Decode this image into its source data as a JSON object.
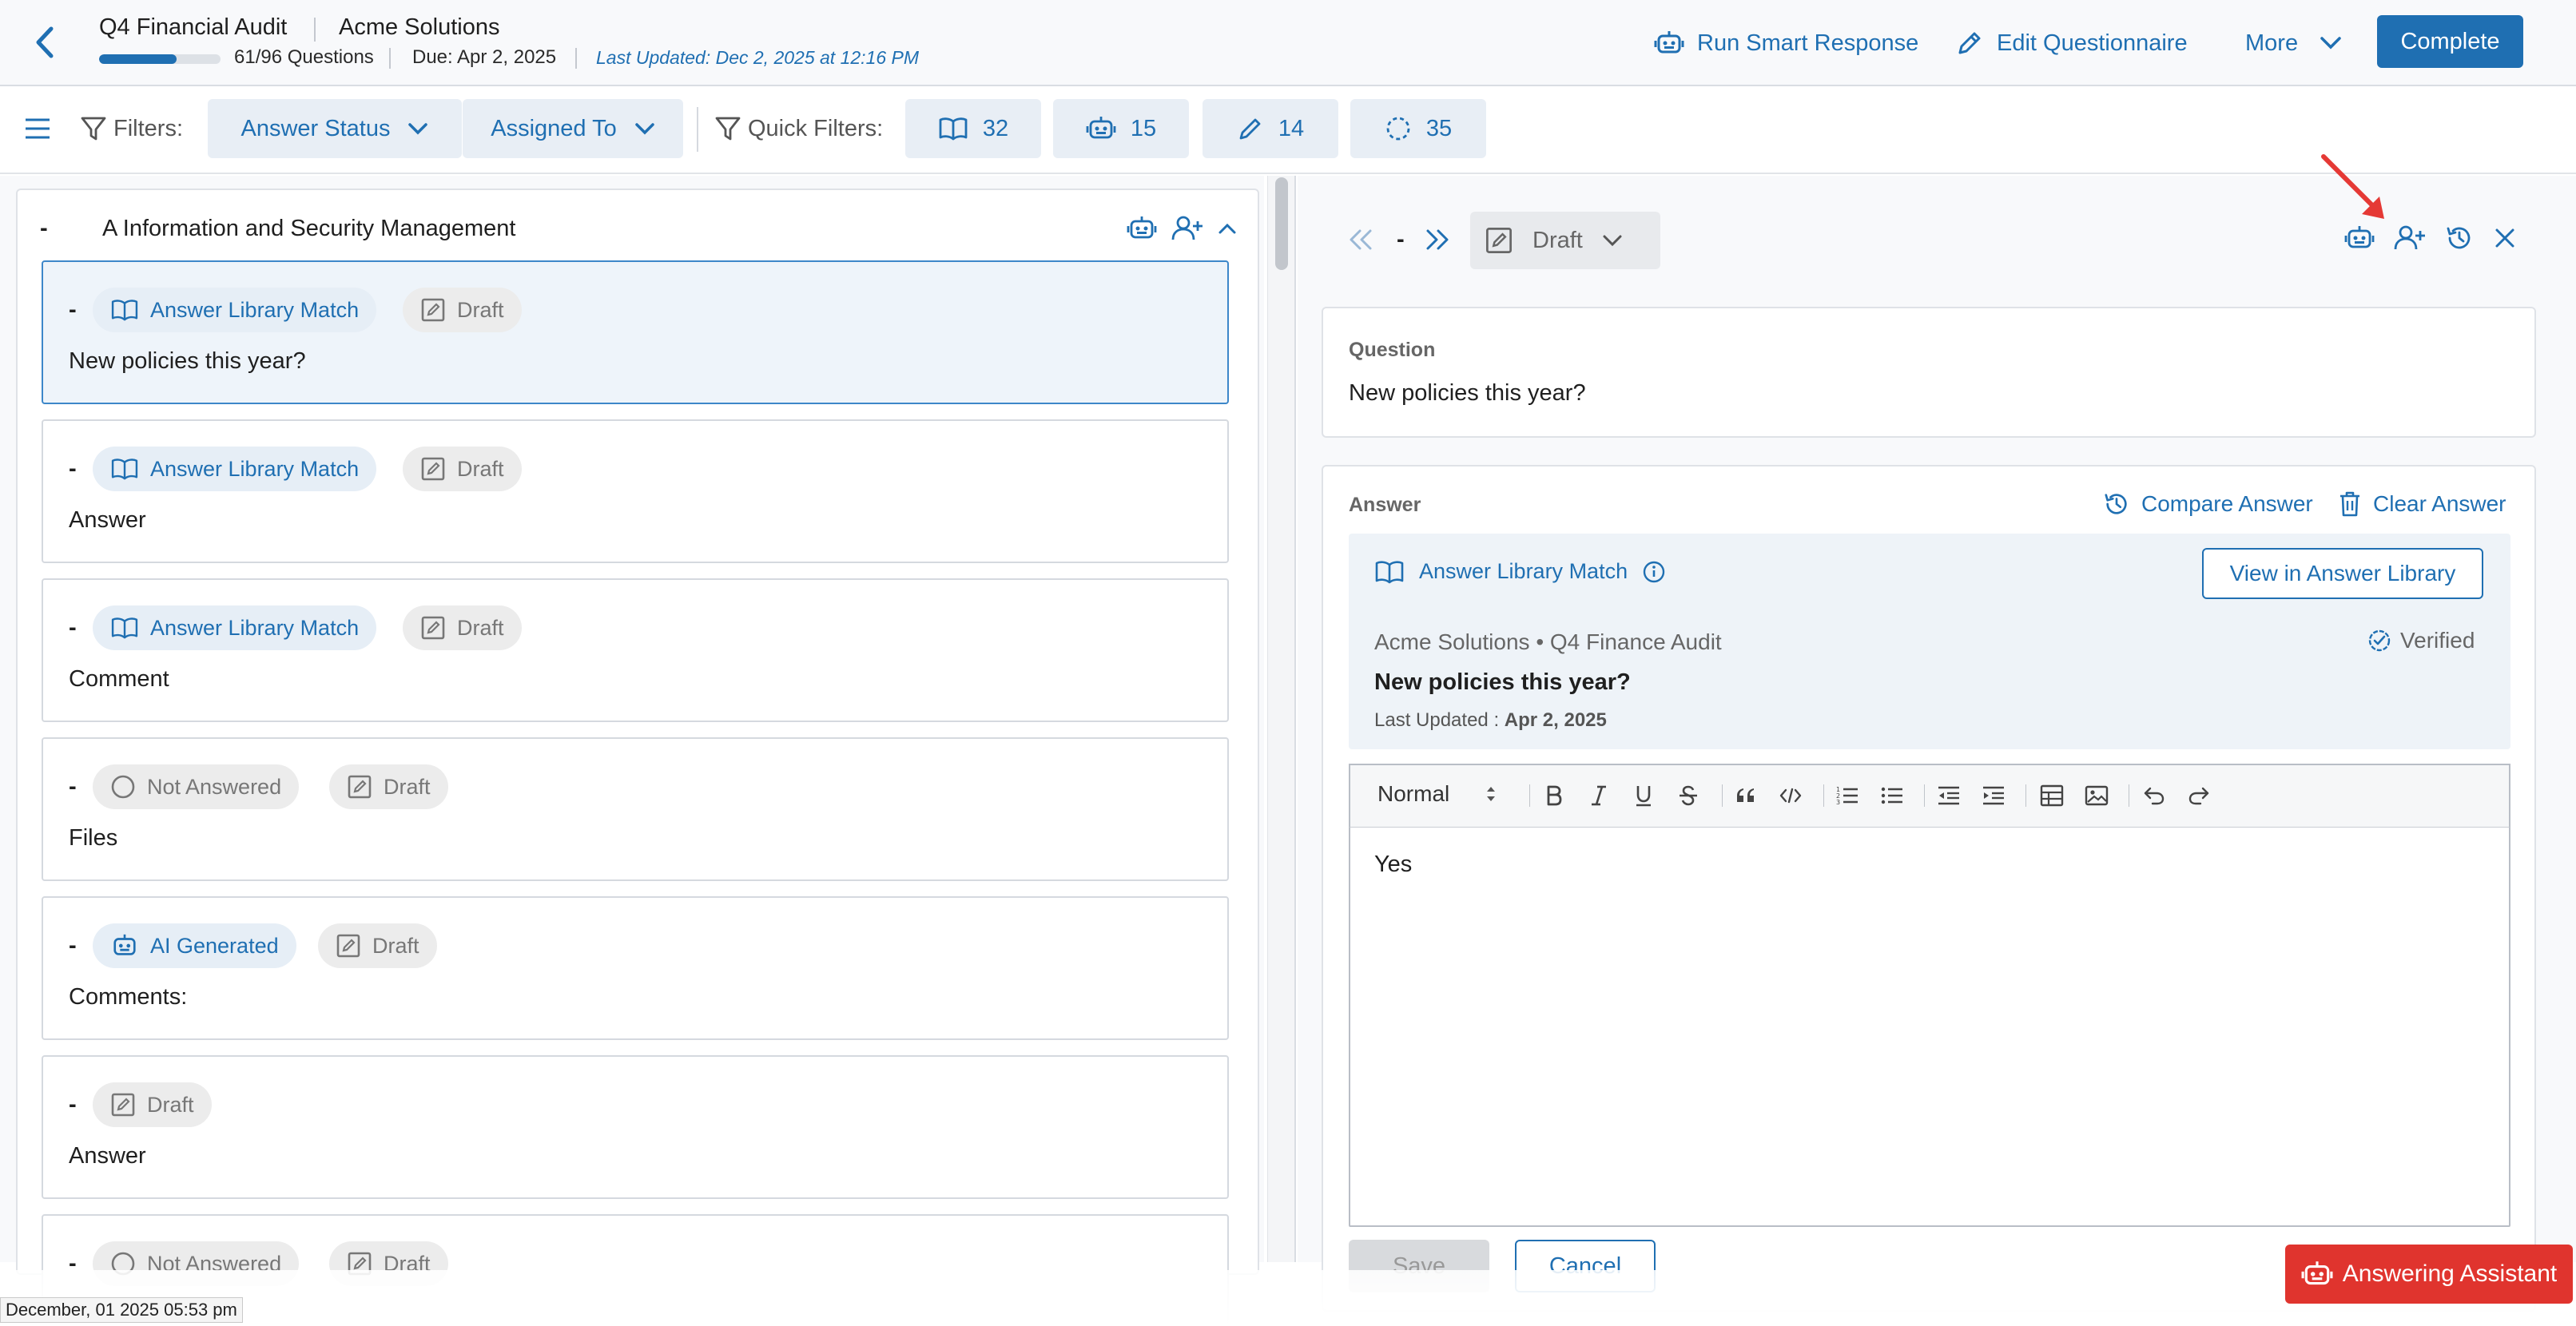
{
  "header": {
    "title": "Q4 Financial Audit",
    "company": "Acme Solutions",
    "progress_text": "61/96 Questions",
    "progress_fraction": 0.635,
    "due": "Due: Apr 2, 2025",
    "last_updated": "Last Updated: Dec 2, 2025 at 12:16 PM",
    "run_smart_response": "Run Smart Response",
    "edit_questionnaire": "Edit Questionnaire",
    "more": "More",
    "complete": "Complete"
  },
  "filters": {
    "label": "Filters:",
    "answer_status": "Answer Status",
    "assigned_to": "Assigned To",
    "quick_filters_label": "Quick Filters:",
    "quick": [
      {
        "icon": "book-icon",
        "count": "32"
      },
      {
        "icon": "robot-icon",
        "count": "15"
      },
      {
        "icon": "pencil-icon",
        "count": "14"
      },
      {
        "icon": "dashed-circle-icon",
        "count": "35"
      }
    ]
  },
  "section": {
    "dash": "-",
    "title": "A Information and Security Management"
  },
  "questions": [
    {
      "dash": "-",
      "chips": [
        "Answer Library Match",
        "Draft"
      ],
      "text": "New policies this year?"
    },
    {
      "dash": "-",
      "chips": [
        "Answer Library Match",
        "Draft"
      ],
      "text": "Answer"
    },
    {
      "dash": "-",
      "chips": [
        "Answer Library Match",
        "Draft"
      ],
      "text": "Comment"
    },
    {
      "dash": "-",
      "chips": [
        "Not Answered",
        "Draft"
      ],
      "text": "Files"
    },
    {
      "dash": "-",
      "chips": [
        "AI Generated",
        "Draft"
      ],
      "text": "Comments:"
    },
    {
      "dash": "-",
      "chips": [
        "Draft"
      ],
      "text": "Answer"
    },
    {
      "dash": "-",
      "chips": [
        "Not Answered",
        "Draft"
      ],
      "text": ""
    }
  ],
  "detail": {
    "nav_dash": "-",
    "status": "Draft",
    "question_label": "Question",
    "question_text": "New policies this year?",
    "answer_label": "Answer",
    "compare_answer": "Compare Answer",
    "clear_answer": "Clear Answer",
    "match_label": "Answer Library Match",
    "view_in_library": "View in Answer Library",
    "match_source": "Acme Solutions • Q4 Finance Audit",
    "verified": "Verified",
    "match_question": "New policies this year?",
    "match_updated_label": "Last Updated : ",
    "match_updated_date": "Apr 2, 2025",
    "editor_format": "Normal",
    "editor_text": "Yes",
    "save": "Save",
    "cancel": "Cancel"
  },
  "footer": {
    "timestamp": "December, 01 2025 05:53 pm",
    "assistant": "Answering Assistant"
  },
  "colors": {
    "accent": "#1f6fb2",
    "danger": "#e0342e",
    "selected_bg": "#eef4fa"
  }
}
